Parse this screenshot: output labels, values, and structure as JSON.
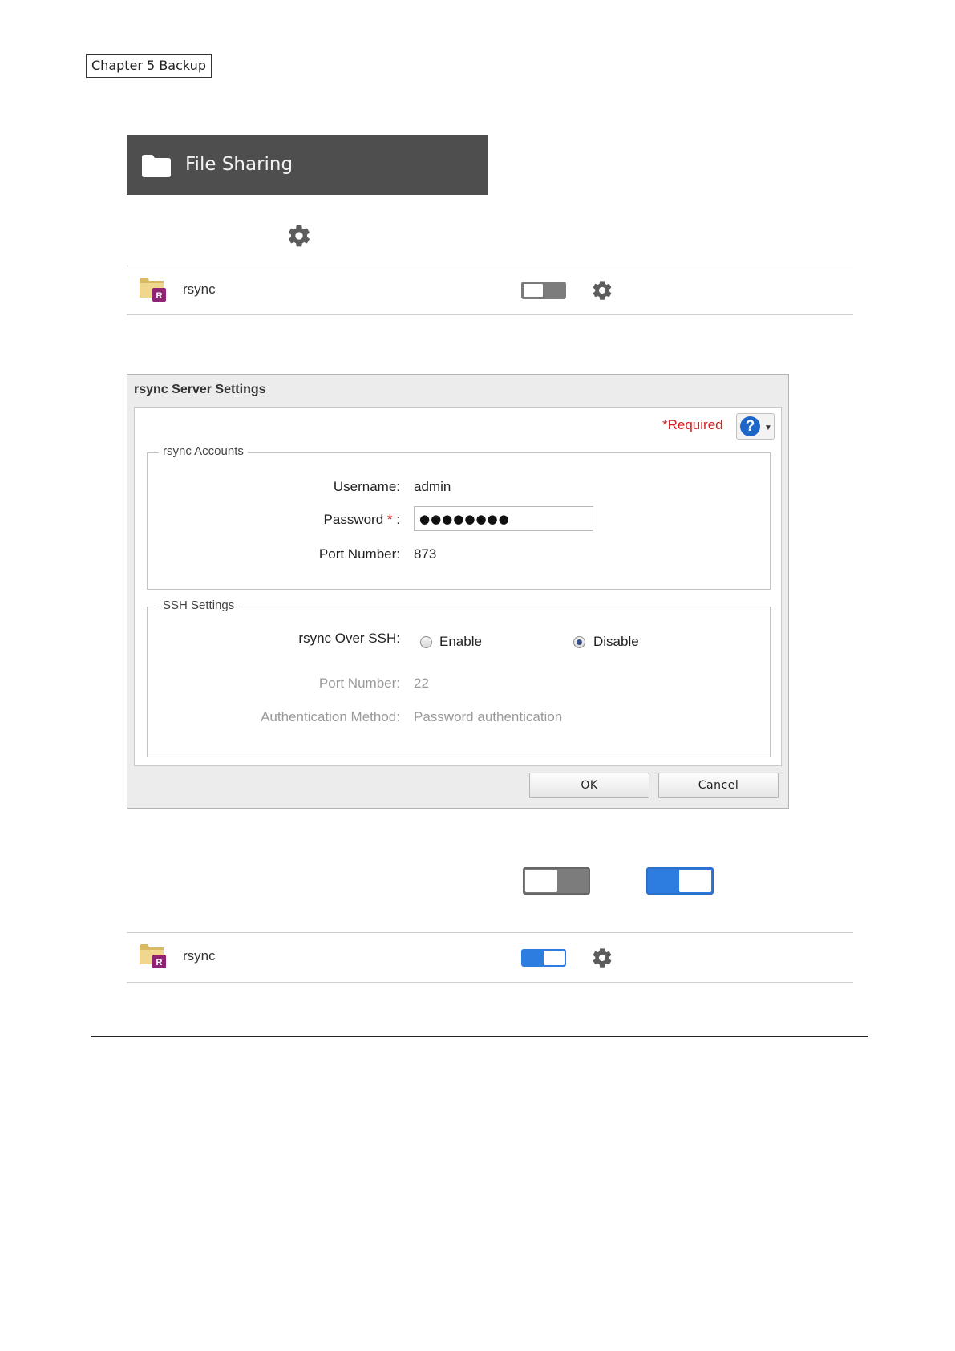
{
  "chapter": {
    "label": "Chapter 5 Backup"
  },
  "banner": {
    "title": "File Sharing",
    "icon": "folder-icon"
  },
  "rows": [
    {
      "label": "rsync",
      "toggle_state": "off",
      "icon": "rsync-folder-icon",
      "badge": "R"
    },
    {
      "label": "rsync",
      "toggle_state": "on",
      "icon": "rsync-folder-icon",
      "badge": "R"
    }
  ],
  "dialog": {
    "title": "rsync Server Settings",
    "required_note": "*Required",
    "help": {
      "glyph": "?",
      "caret": "▼"
    },
    "rsync_accounts": {
      "legend": "rsync Accounts",
      "username_label": "Username:",
      "username_value": "admin",
      "password_label": "Password",
      "password_star": "*",
      "password_colon": ":",
      "password_value": "●●●●●●●●",
      "port_label": "Port Number:",
      "port_value": "873"
    },
    "ssh_settings": {
      "legend": "SSH Settings",
      "over_ssh_label": "rsync Over SSH:",
      "enable_label": "Enable",
      "disable_label": "Disable",
      "selected": "Disable",
      "port_label": "Port Number:",
      "port_value": "22",
      "auth_label": "Authentication Method:",
      "auth_value": "Password authentication"
    },
    "ok_label": "OK",
    "cancel_label": "Cancel"
  },
  "legend_toggles": {
    "off": "off",
    "on": "on"
  },
  "colors": {
    "toggle_on": "#2d7ce0",
    "toggle_off": "#7c7c7c",
    "banner_bg": "#4e4e4e",
    "required": "#d42020"
  }
}
